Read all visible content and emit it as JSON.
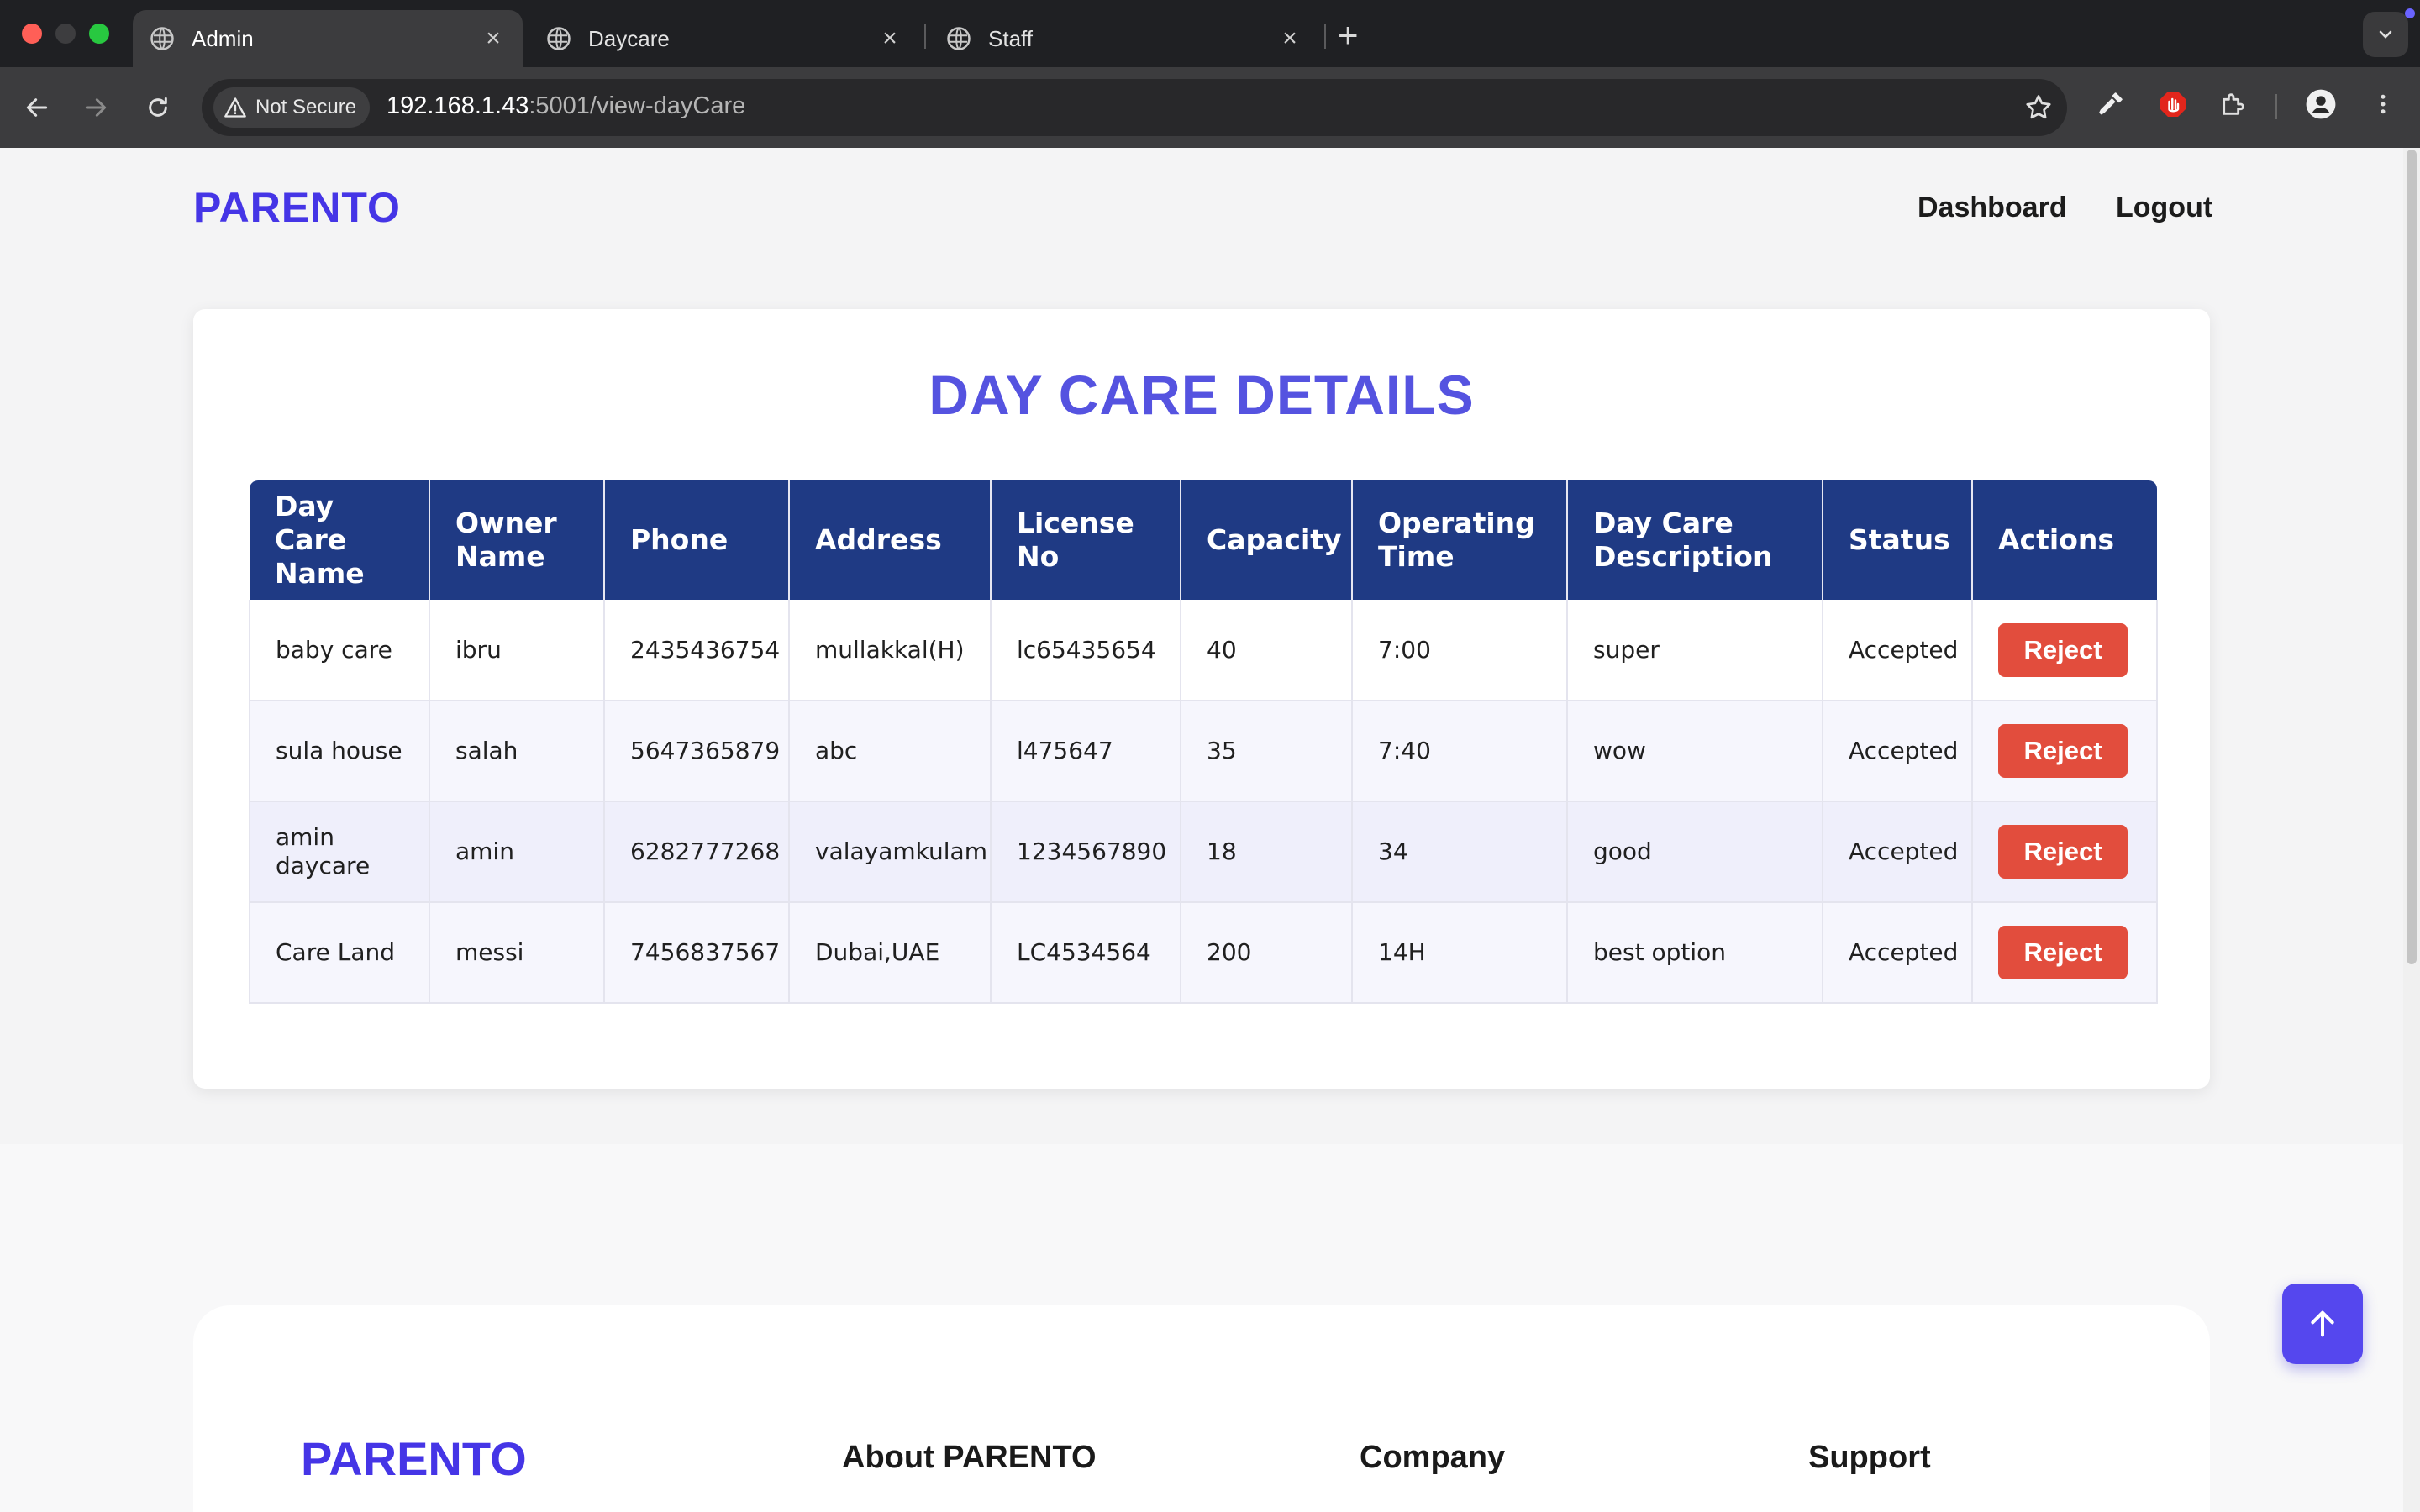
{
  "browser": {
    "tabs": [
      {
        "title": "Admin",
        "active": true
      },
      {
        "title": "Daycare",
        "active": false
      },
      {
        "title": "Staff",
        "active": false
      }
    ],
    "security_label": "Not Secure",
    "url_host": "192.168.1.43",
    "url_rest": ":5001/view-dayCare"
  },
  "site": {
    "logo": "PARENTO",
    "nav": {
      "dashboard": "Dashboard",
      "logout": "Logout"
    }
  },
  "main": {
    "title": "DAY CARE DETAILS",
    "columns": [
      "Day Care Name",
      "Owner Name",
      "Phone",
      "Address",
      "License No",
      "Capacity",
      "Operating Time",
      "Day Care Description",
      "Status",
      "Actions"
    ],
    "rows": [
      {
        "name": "baby care",
        "owner": "ibru",
        "phone": "2435436754",
        "address": "mullakkal(H)",
        "license": "lc65435654",
        "capacity": "40",
        "time": "7:00",
        "description": "super",
        "status": "Accepted",
        "action": "Reject"
      },
      {
        "name": "sula house",
        "owner": "salah",
        "phone": "5647365879",
        "address": "abc",
        "license": "l475647",
        "capacity": "35",
        "time": "7:40",
        "description": "wow",
        "status": "Accepted",
        "action": "Reject"
      },
      {
        "name": "amin daycare",
        "owner": "amin",
        "phone": "6282777268",
        "address": "valayamkulam",
        "license": "1234567890",
        "capacity": "18",
        "time": "34",
        "description": "good",
        "status": "Accepted",
        "action": "Reject"
      },
      {
        "name": "Care Land",
        "owner": "messi",
        "phone": "7456837567",
        "address": "Dubai,UAE",
        "license": "LC4534564",
        "capacity": "200",
        "time": "14H",
        "description": "best option",
        "status": "Accepted",
        "action": "Reject"
      }
    ]
  },
  "footer": {
    "logo": "PARENTO",
    "headings": [
      "About PARENTO",
      "Company",
      "Support"
    ]
  },
  "colors": {
    "brand": "#4535e6",
    "table_header": "#1f3a84",
    "accepted": "#3aa64a",
    "reject": "#e24d3d"
  },
  "icons": [
    "globe-icon",
    "close-icon",
    "plus-icon",
    "back-icon",
    "forward-icon",
    "reload-icon",
    "warning-icon",
    "star-icon",
    "eyedropper-icon",
    "adblock-icon",
    "puzzle-icon",
    "profile-icon",
    "kebab-menu-icon",
    "chevron-down-icon",
    "arrow-up-icon"
  ]
}
